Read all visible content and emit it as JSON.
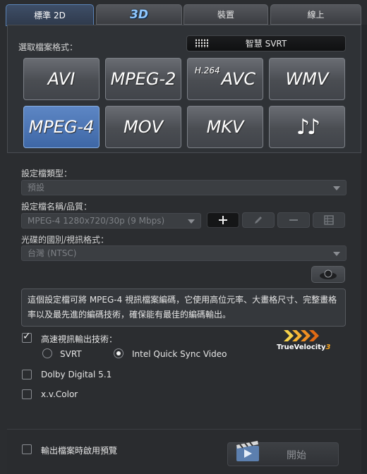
{
  "tabs": {
    "standard_2d": "標準 2D",
    "three_d": "3D",
    "device": "裝置",
    "online": "線上"
  },
  "format": {
    "label": "選取檔案格式：",
    "svrt_button": "智慧 SVRT",
    "buttons": {
      "avi": "AVI",
      "mpeg2": "MPEG-2",
      "h264_sup": "H.264",
      "h264_main": "AVC",
      "wmv": "WMV",
      "mpeg4": "MPEG-4",
      "mov": "MOV",
      "mkv": "MKV",
      "audio": "♪♪"
    },
    "selected": "MPEG-4"
  },
  "profile": {
    "type_label": "設定檔類型：",
    "type_value": "預設",
    "name_label": "設定檔名稱/品質：",
    "name_value": "MPEG-4 1280x720/30p (9 Mbps)",
    "region_label": "光碟的國別/視訊格式：",
    "region_value": "台灣 (NTSC)"
  },
  "description": "這個設定檔可將 MPEG-4 視訊檔案編碼，它使用高位元率、大畫格尺寸、完整畫格率以及最先進的編碼技術，確保能有最佳的編碼輸出。",
  "options": {
    "fast_video_label": "高速視訊輸出技術：",
    "fast_video_checked": true,
    "svrt_label": "SVRT",
    "intel_label": "Intel Quick Sync Video",
    "selected_engine": "Intel Quick Sync Video",
    "truevelocity_text": "TrueVelocity",
    "truevelocity_version": "3",
    "dolby_label": "Dolby Digital 5.1",
    "dolby_checked": false,
    "xvcolor_label": "x.v.Color",
    "xvcolor_checked": false
  },
  "footer": {
    "preview_label": "輸出檔案時啟用預覽",
    "preview_checked": false,
    "start_label": "開始"
  },
  "colors": {
    "accent": "#4d7ab9",
    "selected_format": "#4f78b5",
    "tv_orange": "#f0a020"
  }
}
